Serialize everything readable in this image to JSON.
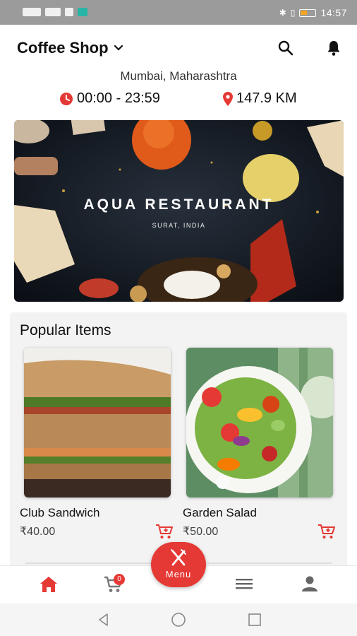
{
  "status_bar": {
    "time": "14:57"
  },
  "header": {
    "shop_name": "Coffee Shop"
  },
  "location": "Mumbai, Maharashtra",
  "hours": "00:00 - 23:59",
  "distance": "147.9 KM",
  "banner": {
    "title": "AQUA RESTAURANT",
    "subtitle": "SURAT, INDIA"
  },
  "popular": {
    "title": "Popular Items",
    "items": [
      {
        "name": "Club Sandwich",
        "price": "₹40.00"
      },
      {
        "name": "Garden Salad",
        "price": "₹50.00"
      }
    ]
  },
  "bottom_nav": {
    "cart_count": "0",
    "menu_label": "Menu"
  },
  "colors": {
    "accent": "#e53935",
    "status_bar": "#9b9b9b"
  }
}
